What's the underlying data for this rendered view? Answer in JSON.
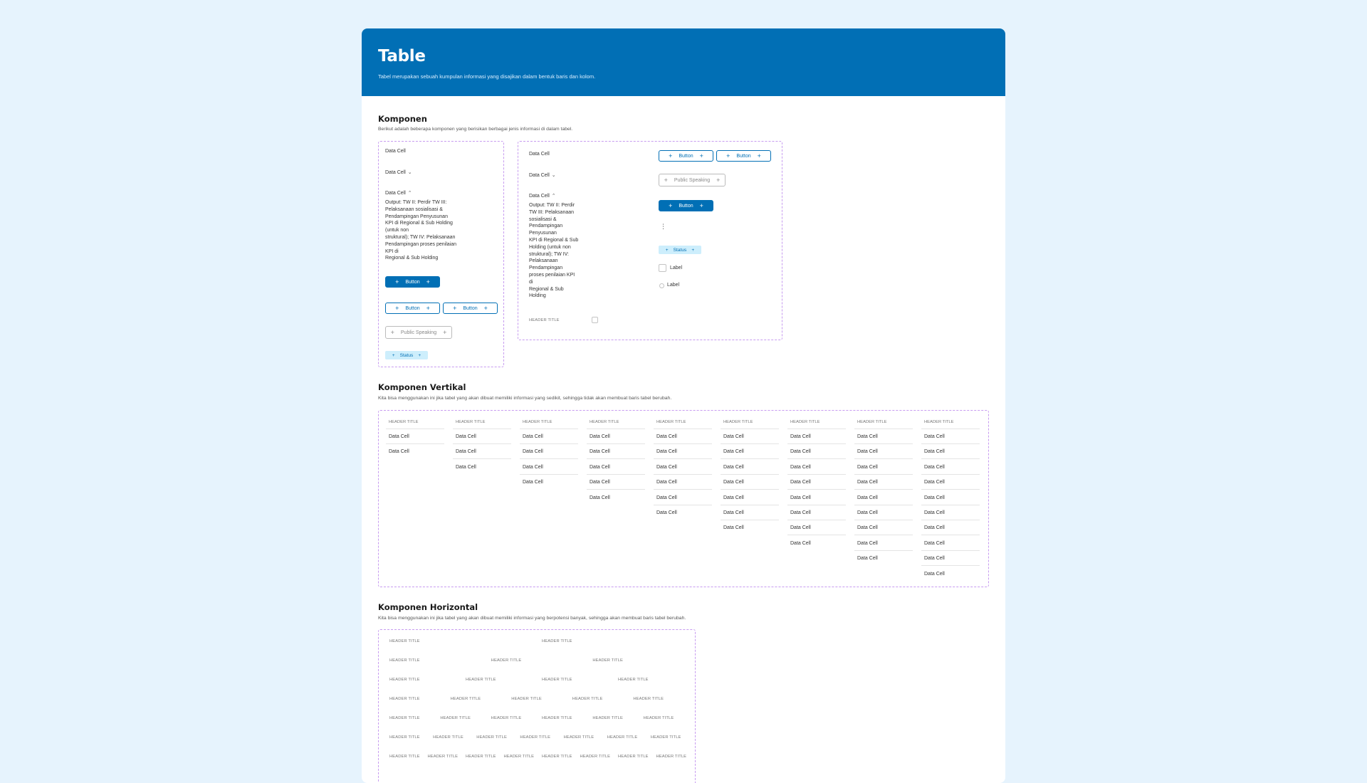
{
  "hero": {
    "title": "Table",
    "subtitle": "Tabel merupakan sebuah kumpulan informasi yang disajikan dalam bentuk baris dan kolom."
  },
  "colors": {
    "page_bg": "#e6f3fd",
    "primary": "#016fb5",
    "dashed_border": "#c79bf0",
    "status_bg": "#cdeefc"
  },
  "komponen": {
    "title": "Komponen",
    "description": "Berikut adalah beberapa komponen yang berisikan berbagai jenis informasi di dalam tabel.",
    "left": {
      "cell_plain": "Data Cell",
      "cell_collapsed": "Data Cell",
      "cell_expanded": "Data Cell",
      "paragraph_lines": [
        "Output: TW II: Perdir TW III:",
        "Pelaksanaan sosialisasi &",
        "Pendampingan Penyusunan",
        "KPI di Regional & Sub Holding",
        "(untuk non",
        "struktural); TW IV: Pelaksanaan",
        "Pendampingan proses penilaian",
        "KPI di",
        "Regional & Sub Holding"
      ],
      "button_solid": "Button",
      "button_outline_1": "Button",
      "button_outline_2": "Button",
      "chip": "Public Speaking",
      "status": "Status"
    },
    "right": {
      "cell_plain": "Data Cell",
      "cell_collapsed": "Data Cell",
      "cell_expanded": "Data Cell",
      "paragraph_lines": [
        "Output: TW II: Perdir",
        "TW III: Pelaksanaan",
        "sosialisasi &",
        "Pendampingan",
        "Penyusunan",
        "KPI di Regional & Sub",
        "Holding (untuk non",
        "struktural); TW IV:",
        "Pelaksanaan",
        "Pendampingan",
        "proses penilaian KPI",
        "di",
        "Regional & Sub",
        "Holding"
      ],
      "header_title": "HEADER TITLE",
      "button_outline_1": "Button",
      "button_outline_2": "Button",
      "chip": "Public Speaking",
      "button_solid": "Button",
      "status": "Status",
      "checkbox_label": "Label",
      "radio_label": "Label"
    }
  },
  "vertikal": {
    "title": "Komponen Vertikal",
    "description": "Kita bisa menggunakan ini jika tabel yang akan dibuat memiliki informasi yang sedikit, sehingga tidak akan membuat baris tabel berubah.",
    "header": "HEADER TITLE",
    "cell": "Data Cell",
    "row_counts": [
      2,
      3,
      4,
      5,
      6,
      7,
      8,
      9,
      10
    ]
  },
  "horizontal": {
    "title": "Komponen Horizontal",
    "description": "Kita bisa menggunakan ini jika tabel yang akan dibuat memiliki informasi yang berpotensi banyak, sehingga akan membuat baris tabel berubah.",
    "header": "HEADER TITLE",
    "column_counts": [
      2,
      3,
      4,
      5,
      6,
      7,
      8
    ]
  }
}
